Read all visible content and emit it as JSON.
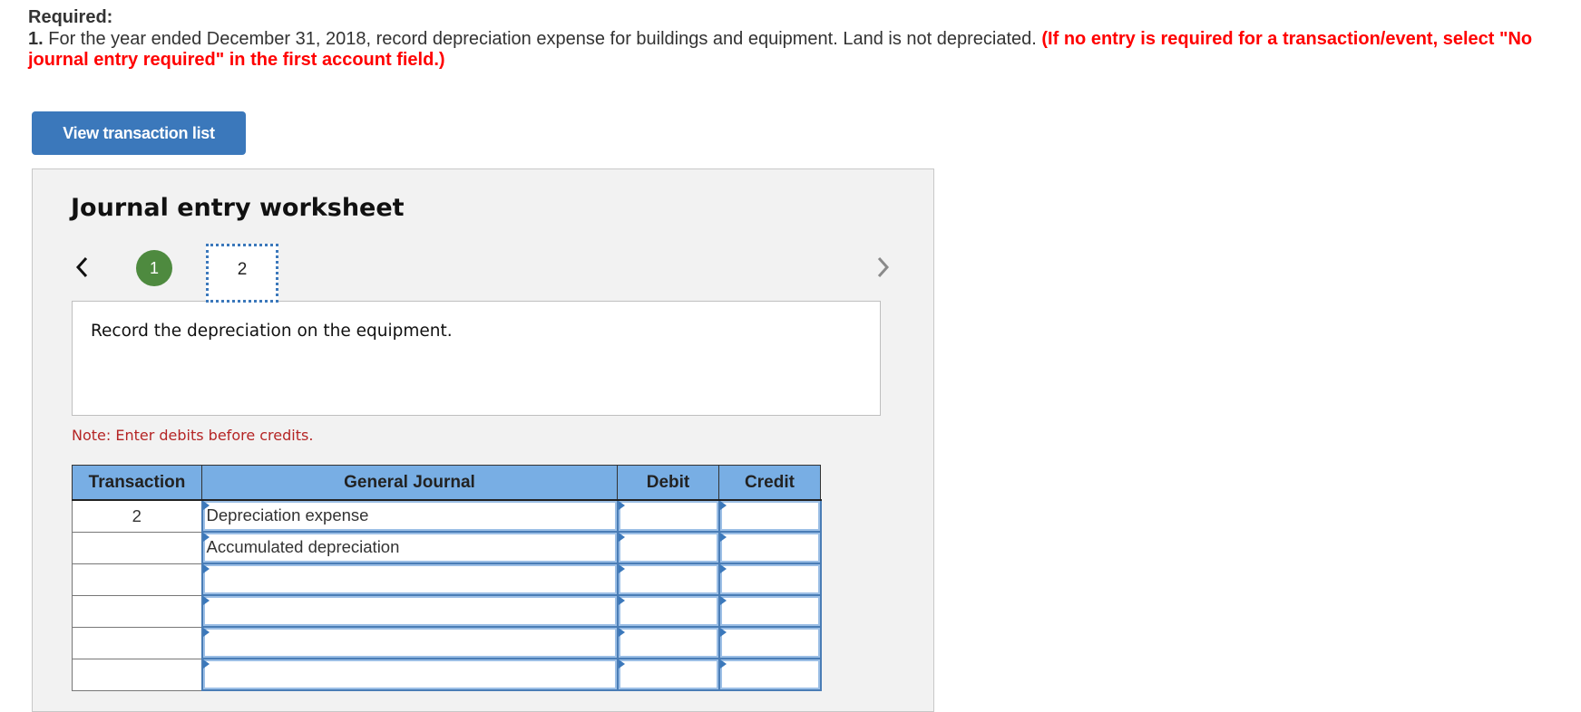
{
  "required": {
    "heading": "Required:",
    "item_number": "1.",
    "instruction": " For the year ended December 31, 2018, record depreciation expense for buildings and equipment. Land is not depreciated. ",
    "instruction_red": "(If no entry is required for a transaction/event, select \"No journal entry required\" in the first account field.)"
  },
  "view_transaction_button": "View transaction list",
  "worksheet": {
    "title": "Journal entry worksheet",
    "nav": {
      "prev_icon": "chevron-left-icon",
      "next_icon": "chevron-right-icon",
      "steps": [
        {
          "label": "1",
          "status": "completed"
        },
        {
          "label": "2",
          "status": "current"
        }
      ]
    },
    "description": "Record the depreciation on the equipment.",
    "note": "Note: Enter debits before credits.",
    "colors": {
      "header_bg": "#78aee4",
      "completed_step": "#4e8a3f",
      "button": "#3b78bb",
      "note": "#b52525"
    },
    "table": {
      "columns": [
        "Transaction",
        "General Journal",
        "Debit",
        "Credit"
      ],
      "rows": [
        {
          "transaction": "2",
          "account": "Depreciation expense",
          "debit": "",
          "credit": ""
        },
        {
          "transaction": "",
          "account": "Accumulated depreciation",
          "debit": "",
          "credit": ""
        },
        {
          "transaction": "",
          "account": "",
          "debit": "",
          "credit": ""
        },
        {
          "transaction": "",
          "account": "",
          "debit": "",
          "credit": ""
        },
        {
          "transaction": "",
          "account": "",
          "debit": "",
          "credit": ""
        },
        {
          "transaction": "",
          "account": "",
          "debit": "",
          "credit": ""
        }
      ]
    }
  }
}
